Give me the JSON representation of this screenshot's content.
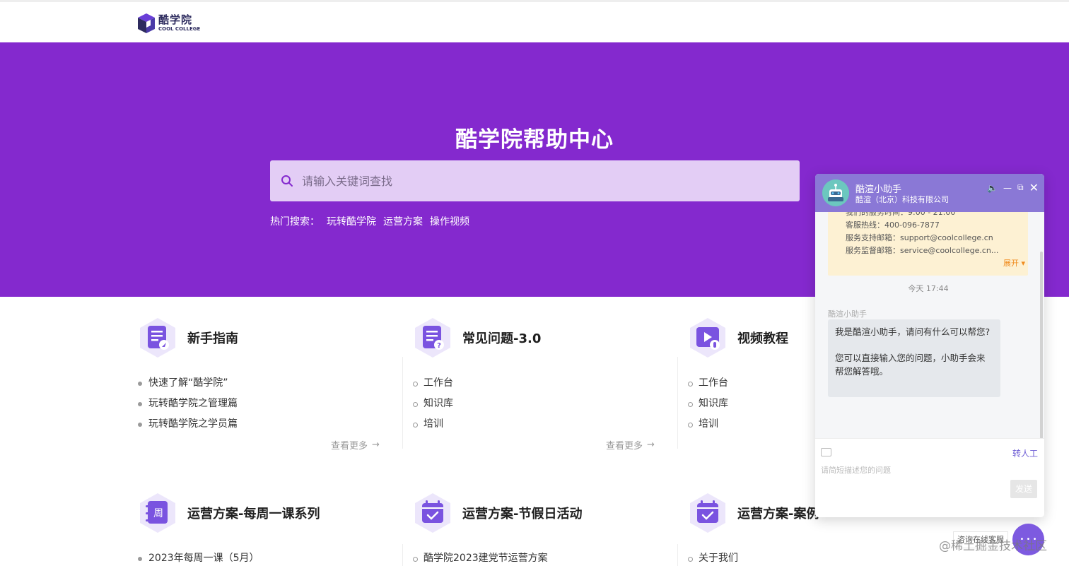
{
  "logo": {
    "cn": "酷学院",
    "en": "COOL COLLEGE"
  },
  "hero": {
    "title": "酷学院帮助中心",
    "search_placeholder": "请输入关键词查找",
    "hot_label": "热门搜索：",
    "hot_items": [
      "玩转酷学院",
      "运营方案",
      "操作视频"
    ]
  },
  "categories": [
    {
      "title": "新手指南",
      "items": [
        "快速了解“酷学院”",
        "玩转酷学院之管理篇",
        "玩转酷学院之学员篇"
      ],
      "more": "查看更多"
    },
    {
      "title": "常见问题-3.0",
      "items": [
        "工作台",
        "知识库",
        "培训"
      ],
      "more": "查看更多"
    },
    {
      "title": "视频教程",
      "items": [
        "工作台",
        "知识库",
        "培训"
      ]
    },
    {
      "title": "运营方案-每周一课系列",
      "items": [
        "2023年每周一课（5月）"
      ]
    },
    {
      "title": "运营方案-节假日活动",
      "items": [
        "酷学院2023建党节运营方案"
      ]
    },
    {
      "title": "运营方案-案例",
      "items": [
        "关于我们"
      ]
    }
  ],
  "chat": {
    "name": "酷渲小助手",
    "company": "酷渲（北京）科技有限公司",
    "notice": {
      "hours": "我们的服务时间：9:00 - 21:00",
      "hotline": "客服热线：400-096-7877",
      "support_email": "服务支持邮箱：support@coolcollege.cn",
      "supervise_email": "服务监督邮箱：service@coolcollege.cn...",
      "expand": "展开"
    },
    "timestamp": "今天 17:44",
    "bot_name": "酷渲小助手",
    "message_1": "我是酷渲小助手，请问有什么可以帮您?",
    "message_2": "您可以直接输入您的问题，小助手会来帮您解答哦。",
    "transfer": "转人工",
    "input_placeholder": "请简短描述您的问题",
    "send": "发送"
  },
  "consult_label": "咨询在线客服",
  "watermark": "@稀土掘金技术社区",
  "colors": {
    "brand_purple": "#8429ce",
    "chat_header": "#8a78d6"
  }
}
